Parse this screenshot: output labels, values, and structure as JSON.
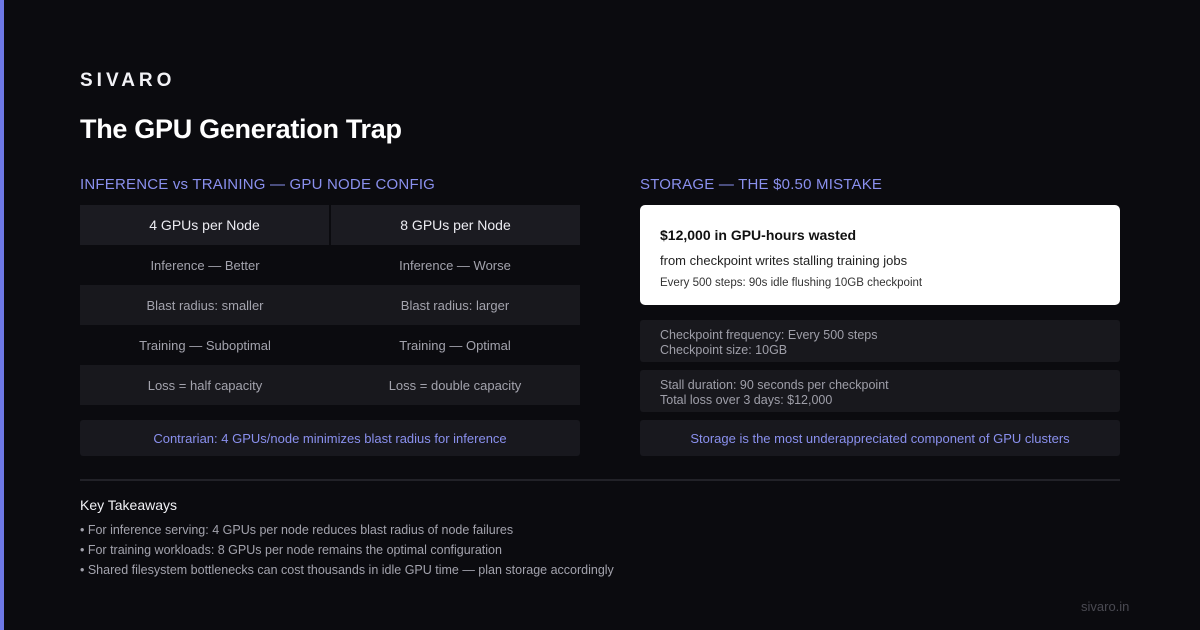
{
  "brand": "SIVARO",
  "title": "The GPU Generation Trap",
  "left": {
    "heading": "INFERENCE vs TRAINING — GPU NODE CONFIG",
    "columns": [
      "4 GPUs per Node",
      "8 GPUs per Node"
    ],
    "rows": [
      [
        "Inference — Better",
        "Inference — Worse"
      ],
      [
        "Blast radius: smaller",
        "Blast radius: larger"
      ],
      [
        "Training — Suboptimal",
        "Training — Optimal"
      ],
      [
        "Loss = half capacity",
        "Loss = double capacity"
      ]
    ],
    "callout": "Contrarian: 4 GPUs/node minimizes blast radius for inference"
  },
  "right": {
    "heading": "STORAGE — THE $0.50 MISTAKE",
    "hero": {
      "title": "$12,000 in GPU-hours wasted",
      "subtitle": "from checkpoint writes stalling training jobs",
      "note": "Every 500 steps: 90s idle flushing 10GB checkpoint"
    },
    "stats": [
      [
        "Checkpoint frequency: Every 500 steps",
        "Checkpoint size: 10GB"
      ],
      [
        "Stall duration: 90 seconds per checkpoint",
        "Total loss over 3 days: $12,000"
      ]
    ],
    "callout": "Storage is the most underappreciated component of GPU clusters"
  },
  "takeaways": {
    "heading": "Key Takeaways",
    "items": [
      "• For inference serving: 4 GPUs per node reduces blast radius of node failures",
      "• For training workloads: 8 GPUs per node remains the optimal configuration",
      "• Shared filesystem bottlenecks can cost thousands in idle GPU time — plan storage accordingly"
    ]
  },
  "footer": "sivaro.in",
  "colors": {
    "accent": "#6e78e6",
    "heading": "#8a90ee",
    "background": "#0b0b0f"
  }
}
